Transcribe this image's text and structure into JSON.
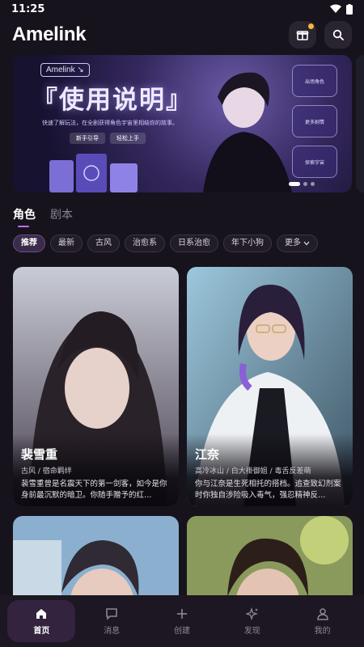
{
  "status": {
    "time": "11:25"
  },
  "app": {
    "title": "Amelink"
  },
  "header": {
    "gift_icon": "gift-icon",
    "search_icon": "search-icon"
  },
  "banner": {
    "tag": "Amelink ↘",
    "title": "『使用说明』",
    "subtitle": "快速了解玩法，在全剧获得角色宇宙里相结你的故事。",
    "chips": [
      "新手引导",
      "轻松上手"
    ],
    "cards": [
      "出场角色",
      "更多剧情",
      "探索宇宙"
    ],
    "book_title": "使用说明"
  },
  "tabs": [
    "角色",
    "剧本"
  ],
  "filters": [
    "推荐",
    "最新",
    "古风",
    "治愈系",
    "日系治愈",
    "年下小狗"
  ],
  "filter_more": "更多",
  "cards": [
    {
      "name": "裴雪重",
      "tags": "古风 / 宿命羁绊",
      "desc": "裴雪重曾是名震天下的第一剑客，如今是你身前最沉默的暗卫。你随手赠予的红…"
    },
    {
      "name": "江奈",
      "tags": "高冷冰山 / 白大褂御姐 / 毒舌反差萌",
      "desc": "你与江奈是生死相托的搭档。追查致幻剂案时你独自涉险吸入毒气，强忍精神反…"
    },
    {
      "name": "",
      "tags": "",
      "desc": ""
    },
    {
      "name": "",
      "tags": "",
      "desc": ""
    }
  ],
  "nav": [
    {
      "label": "首页",
      "icon": "home-icon"
    },
    {
      "label": "消息",
      "icon": "message-icon"
    },
    {
      "label": "创建",
      "icon": "plus-icon"
    },
    {
      "label": "发现",
      "icon": "sparkle-icon"
    },
    {
      "label": "我的",
      "icon": "profile-icon"
    }
  ],
  "colors": {
    "background": "#17131d",
    "accent": "#c76bf2",
    "active_tab_bg": "#33233f"
  }
}
